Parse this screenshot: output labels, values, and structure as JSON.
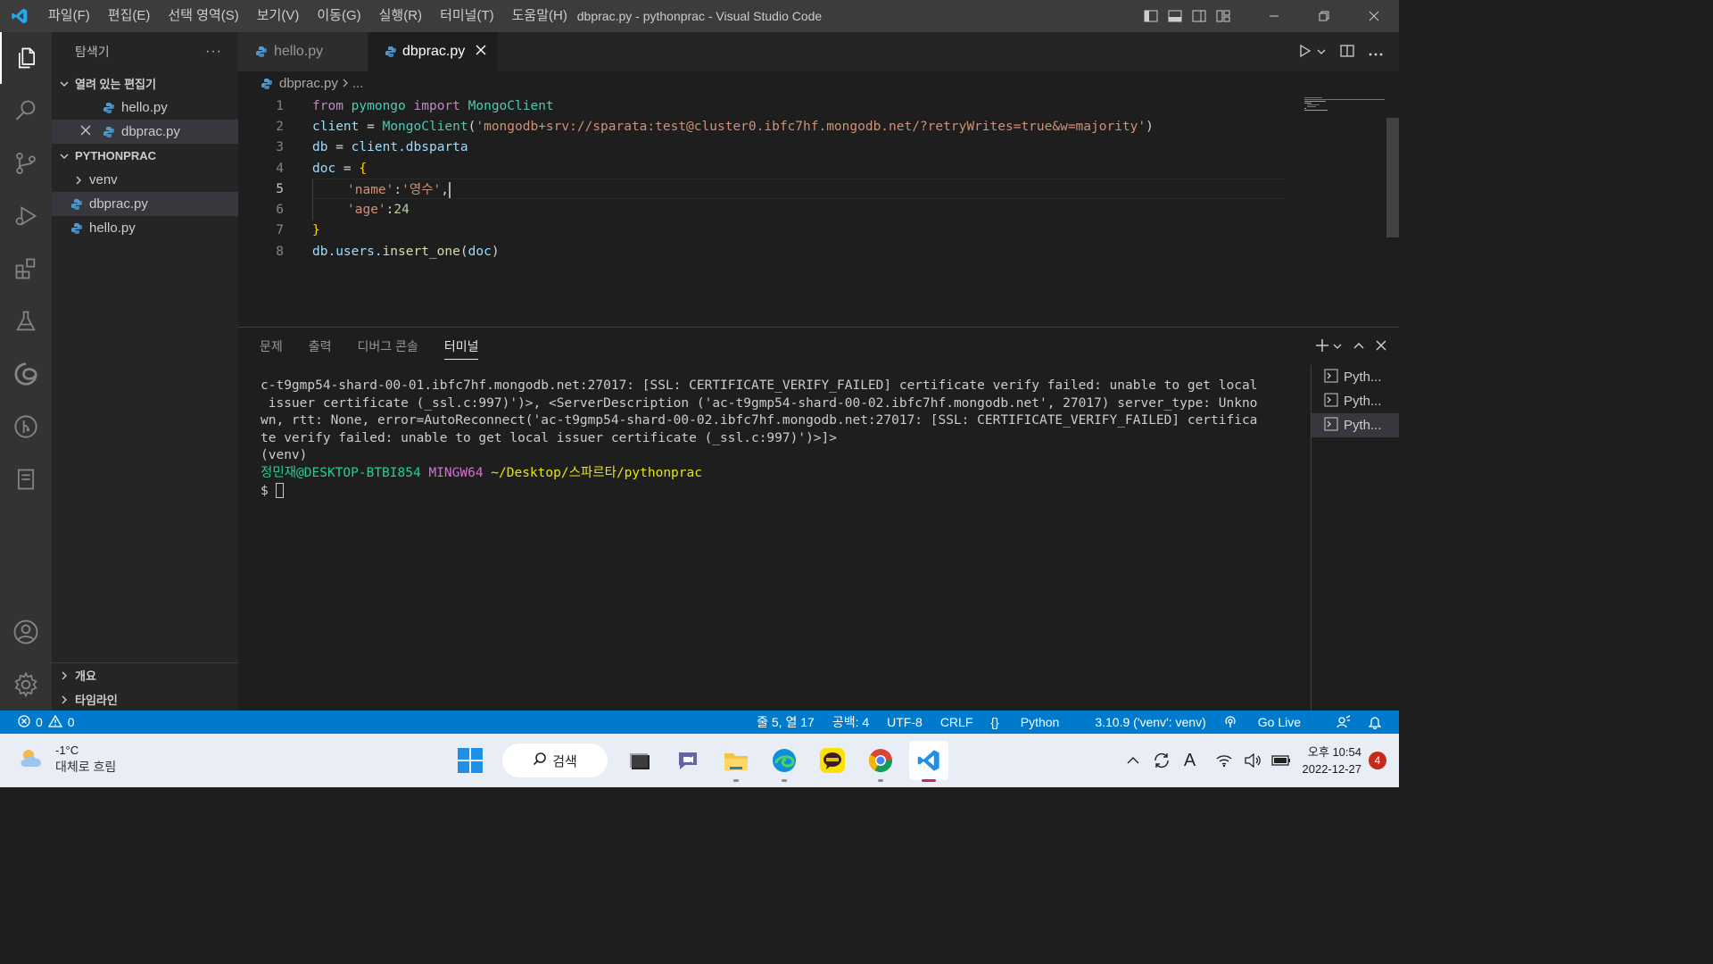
{
  "window": {
    "title": "dbprac.py - pythonprac - Visual Studio Code",
    "menu": [
      "파일(F)",
      "편집(E)",
      "선택 영역(S)",
      "보기(V)",
      "이동(G)",
      "실행(R)",
      "터미널(T)",
      "도움말(H)"
    ]
  },
  "sidebar": {
    "title": "탐색기",
    "more": "···",
    "open_editors_label": "열려 있는 편집기",
    "open_editors": [
      "hello.py",
      "dbprac.py"
    ],
    "project_label": "PYTHONPRAC",
    "tree": [
      "venv",
      "dbprac.py",
      "hello.py"
    ],
    "outline_label": "개요",
    "timeline_label": "타임라인"
  },
  "tabs": [
    "hello.py",
    "dbprac.py"
  ],
  "breadcrumb": {
    "file": "dbprac.py",
    "rest": "..."
  },
  "code": {
    "line_numbers": [
      "1",
      "2",
      "3",
      "4",
      "5",
      "6",
      "7",
      "8"
    ],
    "l1": {
      "from": "from",
      "mod": "pymongo",
      "imp": "import",
      "cls": "MongoClient"
    },
    "l2": {
      "var": "client",
      "eq": " = ",
      "fn": "MongoClient",
      "open": "(",
      "str": "'mongodb+srv://sparata:test@cluster0.ibfc7hf.mongodb.net/?retryWrites=true&w=majority'",
      "close": ")"
    },
    "l3": {
      "var": "db",
      "eq": " = ",
      "obj": "client",
      "attr": ".dbsparta"
    },
    "l4": {
      "var": "doc",
      "eq": " = ",
      "brace": "{"
    },
    "l5": {
      "key": "'name'",
      "colon": ":",
      "val": "'영수'",
      "comma": ","
    },
    "l6": {
      "key": "'age'",
      "colon": ":",
      "val": "24"
    },
    "l7": {
      "brace": "}"
    },
    "l8": {
      "obj": "db",
      "attr": ".users.",
      "fn": "insert_one",
      "open": "(",
      "arg": "doc",
      "close": ")"
    }
  },
  "panel": {
    "tabs": [
      "문제",
      "출력",
      "디버그 콘솔",
      "터미널"
    ],
    "terminal_lines": [
      "c-t9gmp54-shard-00-01.ibfc7hf.mongodb.net:27017: [SSL: CERTIFICATE_VERIFY_FAILED] certificate verify failed: unable to get local",
      " issuer certificate (_ssl.c:997)')>, <ServerDescription ('ac-t9gmp54-shard-00-02.ibfc7hf.mongodb.net', 27017) server_type: Unkno",
      "wn, rtt: None, error=AutoReconnect('ac-t9gmp54-shard-00-02.ibfc7hf.mongodb.net:27017: [SSL: CERTIFICATE_VERIFY_FAILED] certifica",
      "te verify failed: unable to get local issuer certificate (_ssl.c:997)')>]>",
      "(venv)"
    ],
    "prompt": {
      "user": "정민재@DESKTOP-BTBI854",
      "sys": "MINGW64",
      "path": "~/Desktop/스파르타/pythonprac",
      "sign": "$"
    },
    "terminals": [
      "Pyth...",
      "Pyth...",
      "Pyth..."
    ]
  },
  "status": {
    "errors": "0",
    "warnings": "0",
    "position": "줄 5, 열 17",
    "spaces": "공백: 4",
    "encoding": "UTF-8",
    "eol": "CRLF",
    "language": "Python",
    "interpreter": "3.10.9 ('venv': venv)",
    "golive": "Go Live"
  },
  "taskbar": {
    "temp": "-1°C",
    "weather": "대체로 흐림",
    "search": "검색",
    "time": "오후 10:54",
    "date": "2022-12-27",
    "notifications": "4",
    "ime": "A"
  }
}
